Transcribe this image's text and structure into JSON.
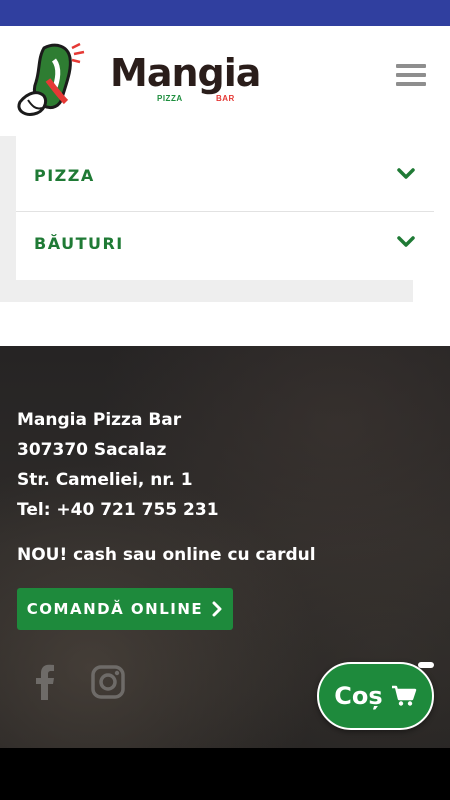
{
  "header": {
    "logo_text": "Mangia",
    "logo_sub_pizza": "PIZZA",
    "logo_sub_bar": "BAR",
    "menu_icon": "hamburger-menu-icon"
  },
  "menu": {
    "items": [
      {
        "label": "PIZZA",
        "icon": "chevron-down-icon"
      },
      {
        "label": "BĂUTURI",
        "icon": "chevron-down-icon"
      }
    ]
  },
  "footer": {
    "address_lines": [
      "Mangia Pizza Bar",
      "307370 Sacalaz",
      "Str. Cameliei, nr. 1",
      "Tel: +40 721 755 231"
    ],
    "payment_note": "NOU! cash sau online cu cardul",
    "order_button_label": "COMANDĂ ONLINE",
    "order_button_icon": "chevron-right-icon",
    "social": [
      "facebook-icon",
      "instagram-icon"
    ]
  },
  "cart": {
    "label": "Coș",
    "icon": "shopping-cart-icon"
  },
  "colors": {
    "brand_green": "#1e8a3c",
    "status_bar": "#303f9f",
    "footer_bg": "#2a2827"
  }
}
